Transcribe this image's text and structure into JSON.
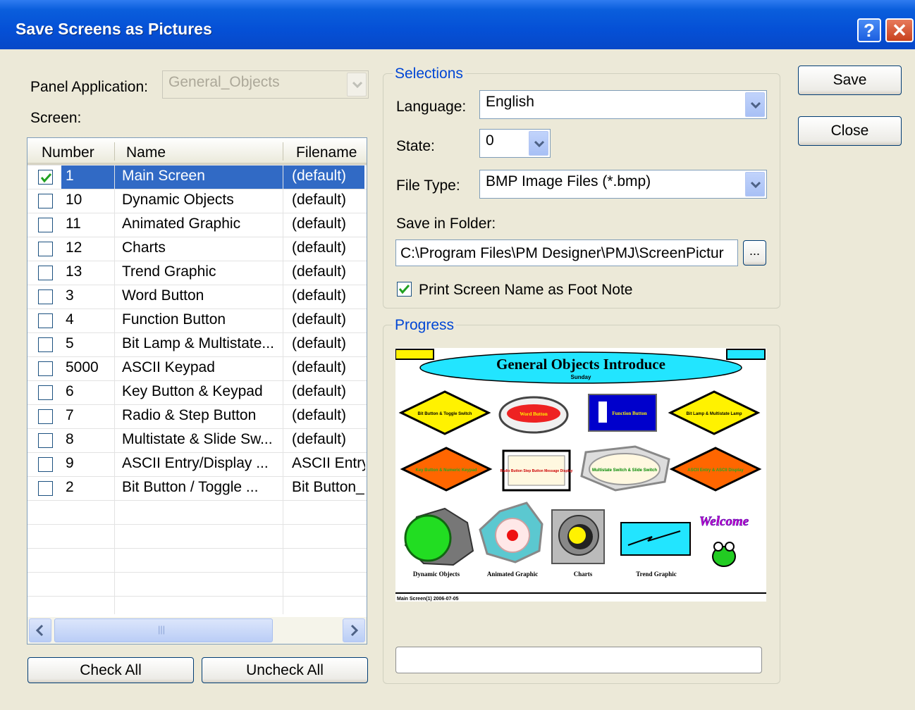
{
  "window": {
    "title": "Save Screens as Pictures",
    "help_glyph": "?",
    "close_glyph": "✕"
  },
  "panel_application": {
    "label": "Panel Application:",
    "value": "General_Objects"
  },
  "screen": {
    "label": "Screen:",
    "columns": [
      "Number",
      "Name",
      "Filename"
    ],
    "rows": [
      {
        "checked": true,
        "number": "1",
        "name": "Main Screen",
        "filename": "(default)"
      },
      {
        "checked": false,
        "number": "10",
        "name": "Dynamic Objects",
        "filename": "(default)"
      },
      {
        "checked": false,
        "number": "11",
        "name": "Animated Graphic",
        "filename": "(default)"
      },
      {
        "checked": false,
        "number": "12",
        "name": "Charts",
        "filename": "(default)"
      },
      {
        "checked": false,
        "number": "13",
        "name": "Trend Graphic",
        "filename": "(default)"
      },
      {
        "checked": false,
        "number": "3",
        "name": "Word Button",
        "filename": "(default)"
      },
      {
        "checked": false,
        "number": "4",
        "name": "Function Button",
        "filename": "(default)"
      },
      {
        "checked": false,
        "number": "5",
        "name": "Bit Lamp & Multistate...",
        "filename": "(default)"
      },
      {
        "checked": false,
        "number": "5000",
        "name": "ASCII Keypad",
        "filename": "(default)"
      },
      {
        "checked": false,
        "number": "6",
        "name": "Key Button & Keypad",
        "filename": "(default)"
      },
      {
        "checked": false,
        "number": "7",
        "name": "Radio & Step Button",
        "filename": "(default)"
      },
      {
        "checked": false,
        "number": "8",
        "name": "Multistate & Slide Sw...",
        "filename": "(default)"
      },
      {
        "checked": false,
        "number": "9",
        "name": "ASCII Entry/Display ...",
        "filename": "ASCII Entry"
      },
      {
        "checked": false,
        "number": "2",
        "name": "Bit Button / Toggle ...",
        "filename": "Bit Button_"
      }
    ],
    "scroll_grip": "|||"
  },
  "buttons": {
    "check_all": "Check All",
    "uncheck_all": "Uncheck All",
    "save": "Save",
    "close": "Close"
  },
  "selections": {
    "title": "Selections",
    "language_label": "Language:",
    "language_value": "English",
    "state_label": "State:",
    "state_value": "0",
    "filetype_label": "File Type:",
    "filetype_value": "BMP Image Files (*.bmp)",
    "folder_label": "Save in Folder:",
    "folder_value": "C:\\Program Files\\PM Designer\\PMJ\\ScreenPictur",
    "browse_label": "...",
    "footnote_checked": true,
    "footnote_label": "Print Screen Name as Foot Note"
  },
  "progress": {
    "title": "Progress",
    "percent": 0,
    "preview": {
      "heading": "General Objects Introduce",
      "subheading": "Sunday",
      "captions": [
        "Dynamic Objects",
        "Animated Graphic",
        "Charts",
        "Trend Graphic"
      ],
      "tile_labels": [
        "Bit Button & Toggle Switch",
        "Word Button",
        "Function Button",
        "Bit Lamp & Multistate Lamp",
        "Key Button & Numeric Keypad",
        "Radio Button Step Button Message Display",
        "Multistate Switch & Slide Switch",
        "ASCII Entry & ASCII Display"
      ],
      "welcome": "Welcome",
      "footer": "Main Screen(1) 2006-07-05",
      "colors": {
        "yellow": "#FFF200",
        "orange": "#FF6600",
        "cyan": "#22E5FF",
        "blue": "#0000CC",
        "green": "#22DD22"
      }
    }
  }
}
